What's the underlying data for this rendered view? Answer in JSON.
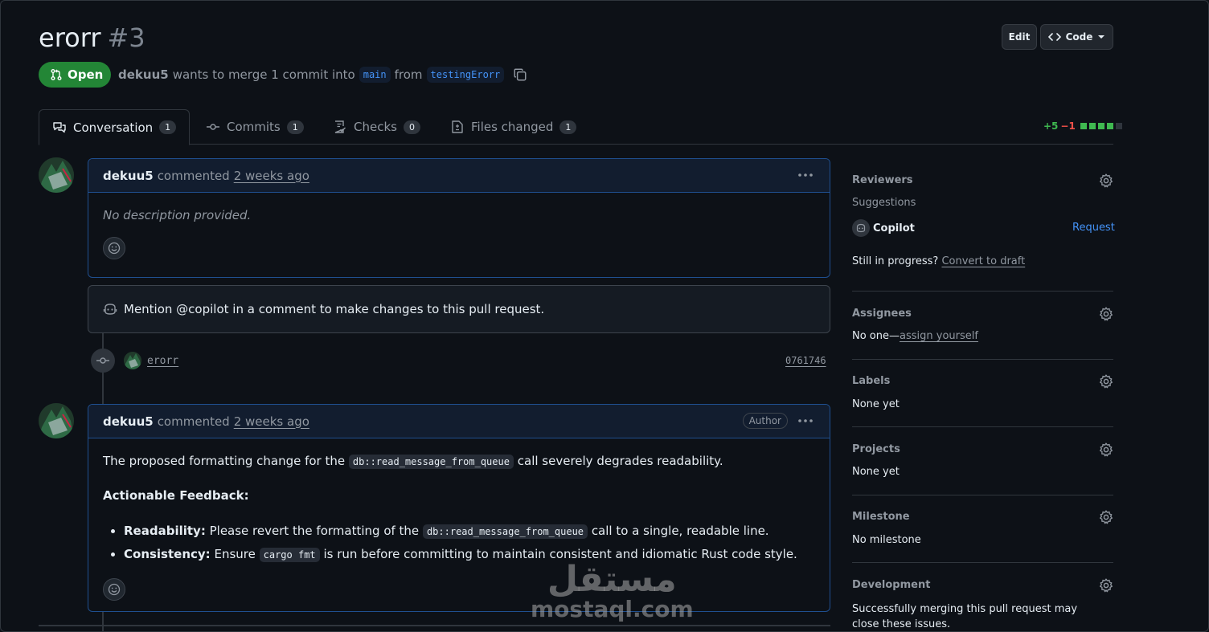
{
  "header": {
    "title": "erorr",
    "number": "#3",
    "edit_label": "Edit",
    "code_label": "Code"
  },
  "state": {
    "label": "Open",
    "author": "dekuu5",
    "merge_text": "wants to merge 1 commit into",
    "base_branch": "main",
    "from_text": "from",
    "head_branch": "testingErorr"
  },
  "tabs": [
    {
      "label": "Conversation",
      "count": "1"
    },
    {
      "label": "Commits",
      "count": "1"
    },
    {
      "label": "Checks",
      "count": "0"
    },
    {
      "label": "Files changed",
      "count": "1"
    }
  ],
  "diffstat": {
    "additions": "+5",
    "deletions": "−1"
  },
  "comments": [
    {
      "author": "dekuu5",
      "action": "commented",
      "time": "2 weeks ago",
      "body": "No description provided."
    },
    {
      "author": "dekuu5",
      "action": "commented",
      "time": "2 weeks ago",
      "badge": "Author",
      "intro_before": "The proposed formatting change for the",
      "intro_code": "db::read_message_from_queue",
      "intro_after": "call severely degrades readability.",
      "feedback_heading": "Actionable Feedback:",
      "items": [
        {
          "label": "Readability:",
          "before": "Please revert the formatting of the",
          "code": "db::read_message_from_queue",
          "after": "call to a single, readable line."
        },
        {
          "label": "Consistency:",
          "before": "Ensure",
          "code": "cargo fmt",
          "after": "is run before committing to maintain consistent and idiomatic Rust code style."
        }
      ]
    }
  ],
  "copilot_notice": "Mention @copilot in a comment to make changes to this pull request.",
  "commit": {
    "message": "erorr",
    "sha": "0761746"
  },
  "sidebar": {
    "reviewers": {
      "title": "Reviewers",
      "suggestions": "Suggestions",
      "suggested_name": "Copilot",
      "request_label": "Request",
      "progress_text": "Still in progress?",
      "draft_link": "Convert to draft"
    },
    "assignees": {
      "title": "Assignees",
      "none_text": "No one—",
      "assign_link": "assign yourself"
    },
    "labels": {
      "title": "Labels",
      "value": "None yet"
    },
    "projects": {
      "title": "Projects",
      "value": "None yet"
    },
    "milestone": {
      "title": "Milestone",
      "value": "No milestone"
    },
    "development": {
      "title": "Development",
      "value": "Successfully merging this pull request may close these issues."
    }
  },
  "watermark": {
    "arabic": "مستقل",
    "latin": "mostaql.com"
  },
  "colors": {
    "background": "#0d1117",
    "open_green": "#238636",
    "link_blue": "#4493f8",
    "comment_border": "#1f4f8f",
    "additions": "#3fb950",
    "deletions": "#f85149"
  }
}
